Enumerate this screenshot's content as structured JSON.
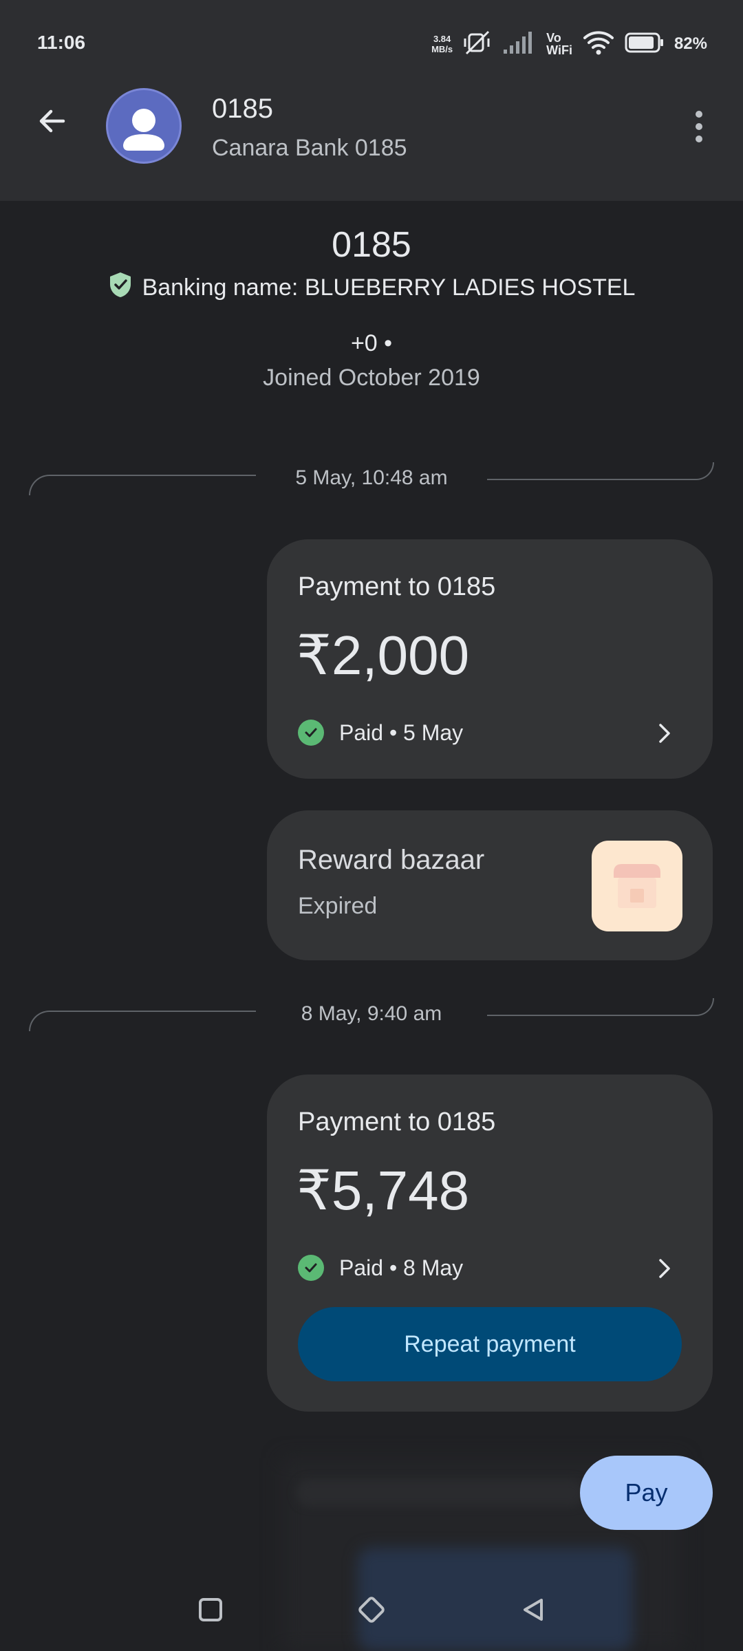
{
  "status_bar": {
    "time": "11:06",
    "net_speed_value": "3.84",
    "net_speed_unit": "MB/s",
    "vowifi_line1": "Vo",
    "vowifi_line2": "WiFi",
    "battery": "82%"
  },
  "header": {
    "title": "0185",
    "subtitle": "Canara Bank 0185",
    "back_icon": "arrow-back-icon",
    "menu_icon": "more-vert-icon"
  },
  "profile": {
    "name": "0185",
    "banking_name": "Banking name: BLUEBERRY LADIES HOSTEL",
    "phone": "+0 •",
    "joined": "Joined October 2019"
  },
  "timeline": [
    {
      "date": "5 May, 10:48 am",
      "payment": {
        "title": "Payment to 0185",
        "amount": "₹2,000",
        "status": "Paid • 5 May"
      },
      "reward": {
        "title": "Reward bazaar",
        "status": "Expired"
      }
    },
    {
      "date": "8 May, 9:40 am",
      "payment": {
        "title": "Payment to 0185",
        "amount": "₹5,748",
        "status": "Paid • 8 May",
        "action": "Repeat payment"
      }
    }
  ],
  "pay_button": "Pay",
  "colors": {
    "background": "#202124",
    "header": "#2d2e31",
    "card": "#333436",
    "paid_green": "#5bb974",
    "repeat_button": "#004a77",
    "pay_button": "#a8c7fa",
    "avatar": "#5c6bc0"
  }
}
